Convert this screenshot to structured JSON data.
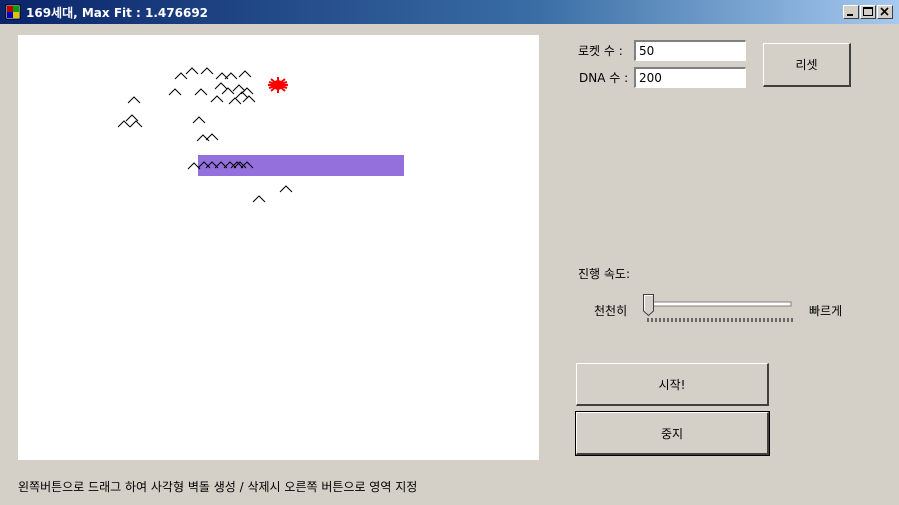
{
  "window": {
    "title": "169세대, Max Fit : 1.476692"
  },
  "form": {
    "rocket_label": "로켓 수 :",
    "rocket_value": "50",
    "dna_label": "DNA 수 :",
    "dna_value": "200",
    "reset_label": "리셋",
    "speed_label": "진행 속도:",
    "slow_label": "천천히",
    "fast_label": "빠르게",
    "speed_value": 0,
    "start_label": "시작!",
    "stop_label": "중지"
  },
  "status": {
    "text": "왼쪽버튼으로 드래그 하여 사각형 벽돌 생성 / 삭제시 오른쪽 버튼으로 영역 지정"
  },
  "colors": {
    "wall": "#9370db",
    "target": "#ff0000",
    "rocket": "#000000"
  },
  "icons": {
    "minimize": "minimize-icon",
    "maximize": "maximize-icon",
    "close": "close-icon",
    "app": "app-icon"
  }
}
